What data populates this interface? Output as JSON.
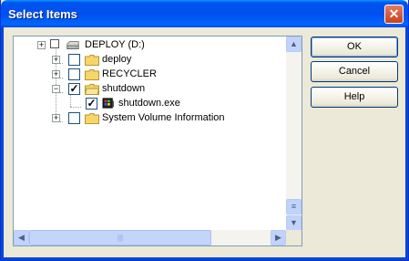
{
  "window": {
    "title": "Select Items",
    "close_glyph": "✕"
  },
  "tree": {
    "root": {
      "label": "DEPLOY (D:)",
      "expander": "+",
      "icon": "drive-icon"
    },
    "items": [
      {
        "label": "deploy",
        "expander": "+",
        "checked": "",
        "icon": "folder-icon"
      },
      {
        "label": "RECYCLER",
        "expander": "+",
        "checked": "",
        "icon": "folder-icon"
      },
      {
        "label": "shutdown",
        "expander": "−",
        "checked": "✓",
        "icon": "folder-open-icon",
        "children": [
          {
            "label": "shutdown.exe",
            "checked": "✓",
            "icon": "exe-file-icon"
          }
        ]
      },
      {
        "label": "System Volume Information",
        "expander": "+",
        "checked": "",
        "icon": "folder-icon"
      }
    ]
  },
  "scrollbars": {
    "up": "▲",
    "down": "▼",
    "left": "◀",
    "right": "▶",
    "grip_v": "≡",
    "grip_h": "|||"
  },
  "buttons": {
    "ok": "OK",
    "cancel": "Cancel",
    "help": "Help"
  }
}
